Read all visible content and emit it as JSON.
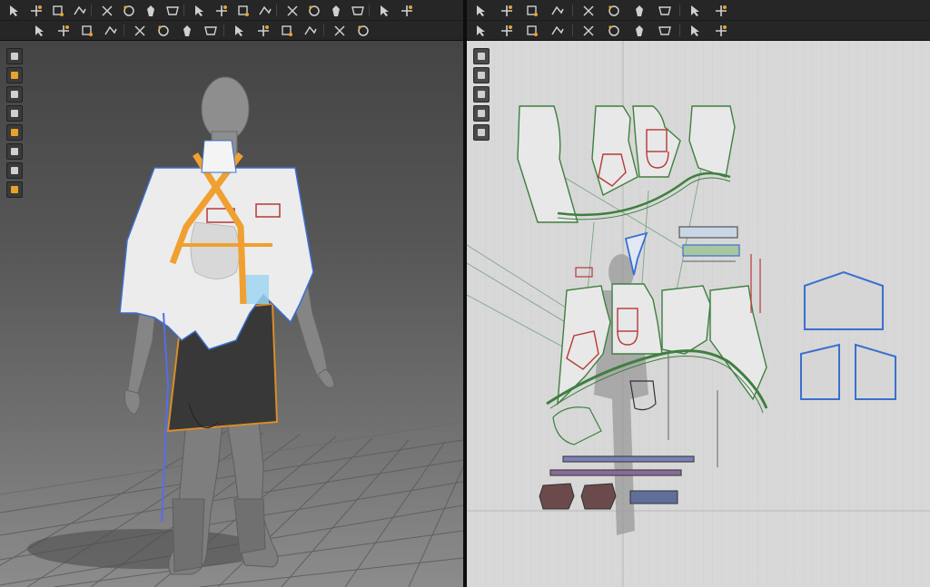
{
  "app": {
    "colors": {
      "toolbar_bg": "#262626",
      "icon_light": "#d0d0d0",
      "icon_accent": "#e8a32b",
      "viewport3d_top": "#444444",
      "viewport2d_bg": "#d8d8d8",
      "seam_orange": "#f0a030",
      "selected_blue": "#3b6fd0",
      "pattern_outline": "#3f7f3f",
      "internal_line_red": "#b83838"
    }
  },
  "toolbar_3d": {
    "row1_icons": [
      "transform-pattern-icon",
      "select-move-icon",
      "transform-point-icon",
      "edit-curvature-icon",
      "segment-line-icon",
      "polygon-icon",
      "rectangle-icon",
      "circle-icon",
      "internal-line-icon",
      "trace-icon",
      "fold-icon",
      "cut-icon",
      "pin-icon",
      "tack-icon",
      "avatar-measure-icon",
      "avatar-pose-icon",
      "stitch-icon",
      "free-stitch-icon"
    ],
    "row2_icons": [
      "button-icon",
      "buttonhole-icon",
      "zipper-icon",
      "puckering-icon",
      "topstitch-icon",
      "shirring-icon",
      "elastic-icon",
      "rib-icon",
      "fold-arrange-icon",
      "measure-icon",
      "texture-icon",
      "graphic-icon",
      "arrange-icon",
      "align-icon"
    ]
  },
  "toolbar_2d": {
    "row1_icons": [
      "transform-pattern-icon",
      "edit-point-icon",
      "add-point-icon",
      "polygon-icon",
      "rectangle-icon",
      "circle-icon",
      "mirror-icon",
      "trace-avatar-icon",
      "grid-icon",
      "grid-snap-icon"
    ],
    "row2_icons": [
      "select-mesh-icon",
      "edit-curve-icon",
      "segment-sewing-icon",
      "free-sewing-icon",
      "edit-texture-icon",
      "topstitch-icon",
      "zipper-icon",
      "annotation-icon",
      "measure-icon",
      "arrange-icon"
    ]
  },
  "sidebar_3d": [
    "display-avatar-icon",
    "show-garment-icon",
    "fabric-color-icon",
    "avatar-body-icon",
    "texture-view-icon",
    "fold-view-icon",
    "skin-icon",
    "globe-icon"
  ],
  "sidebar_2d": [
    "brush-icon",
    "eye-icon",
    "settings-icon",
    "layers-icon",
    "lock-icon"
  ],
  "scene_3d": {
    "garment_color": "#ececec",
    "skirt_color": "#3a3a3a",
    "avatar_color": "#8a8a8a",
    "grid_floor": true
  },
  "scene_2d": {
    "pattern_fill": "#e8e8e8",
    "grid": true
  }
}
